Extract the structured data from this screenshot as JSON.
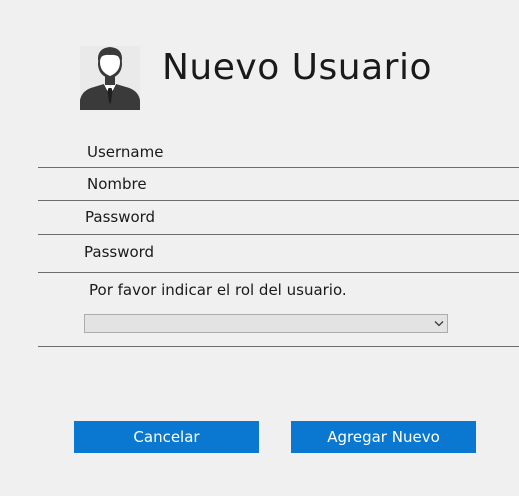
{
  "header": {
    "title": "Nuevo Usuario",
    "avatar_icon": "user-avatar-icon"
  },
  "form": {
    "fields": [
      {
        "name": "username",
        "label": "Username",
        "value": ""
      },
      {
        "name": "nombre",
        "label": "Nombre",
        "value": ""
      },
      {
        "name": "password",
        "label": "Password",
        "value": ""
      },
      {
        "name": "password-confirm",
        "label": "Password",
        "value": ""
      }
    ],
    "role_prompt": "Por favor indicar el rol del usuario.",
    "role_select": {
      "selected": "",
      "icon": "chevron-down-icon"
    }
  },
  "buttons": {
    "cancel_label": "Cancelar",
    "add_label": "Agregar Nuevo",
    "color": "#0a78d0"
  },
  "colors": {
    "background": "#f0f0f0",
    "accent": "#0a78d0"
  }
}
